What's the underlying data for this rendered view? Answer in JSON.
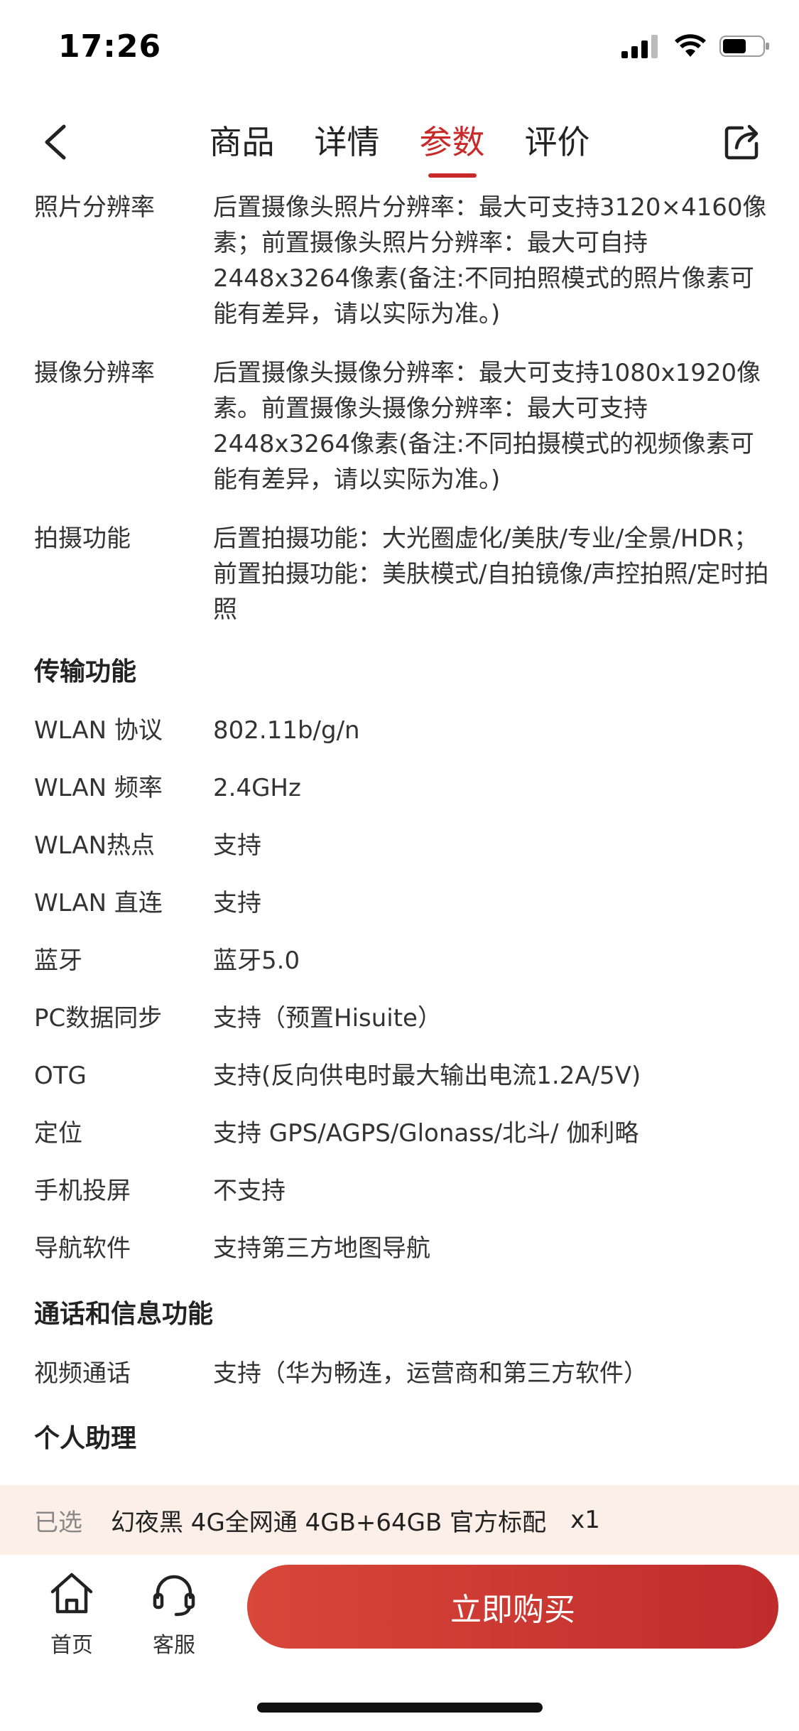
{
  "status_bar": {
    "time": "17:26"
  },
  "nav": {
    "tabs": [
      {
        "label": "商品"
      },
      {
        "label": "详情"
      },
      {
        "label": "参数"
      },
      {
        "label": "评价"
      }
    ],
    "active_tab": "参数"
  },
  "params": {
    "rows": [
      {
        "key": "照片分辨率",
        "value": "后置摄像头照片分辨率：最大可支持3120×4160像素；前置摄像头照片分辨率：最大可自持2448x3264像素(备注:不同拍照模式的照片像素可能有差异，请以实际为准。)"
      },
      {
        "key": "摄像分辨率",
        "value": "后置摄像头摄像分辨率：最大可支持1080x1920像素。前置摄像头摄像分辨率：最大可支持2448x3264像素(备注:不同拍摄模式的视频像素可能有差异，请以实际为准。)"
      },
      {
        "key": "拍摄功能",
        "value": "后置拍摄功能：大光圈虚化/美肤/专业/全景/HDR；前置拍摄功能：美肤模式/自拍镜像/声控拍照/定时拍照"
      }
    ],
    "section_transfer": "传输功能",
    "transfer_rows": [
      {
        "key": "WLAN 协议",
        "value": "802.11b/g/n"
      },
      {
        "key": "WLAN 频率",
        "value": "2.4GHz"
      },
      {
        "key": "WLAN热点",
        "value": "支持"
      },
      {
        "key": "WLAN 直连",
        "value": "支持"
      },
      {
        "key": "蓝牙",
        "value": "蓝牙5.0"
      },
      {
        "key": "PC数据同步",
        "value": "支持（预置Hisuite）"
      },
      {
        "key": "OTG",
        "value": "支持(反向供电时最大输出电流1.2A/5V)"
      },
      {
        "key": "定位",
        "value": "支持 GPS/AGPS/Glonass/北斗/ 伽利略"
      },
      {
        "key": "手机投屏",
        "value": "不支持"
      },
      {
        "key": "导航软件",
        "value": "支持第三方地图导航"
      }
    ],
    "section_call": "通话和信息功能",
    "call_rows": [
      {
        "key": "视频通话",
        "value": "支持（华为畅连，运营商和第三方软件）"
      }
    ],
    "section_assistant": "个人助理"
  },
  "selected": {
    "label": "已选",
    "value": "幻夜黑 4G全网通 4GB+64GB 官方标配",
    "qty": "x1"
  },
  "bottom": {
    "home_label": "首页",
    "service_label": "客服",
    "buy_label": "立即购买"
  },
  "colors": {
    "accent": "#c82a2a",
    "selected_bg": "#fcefe7"
  }
}
